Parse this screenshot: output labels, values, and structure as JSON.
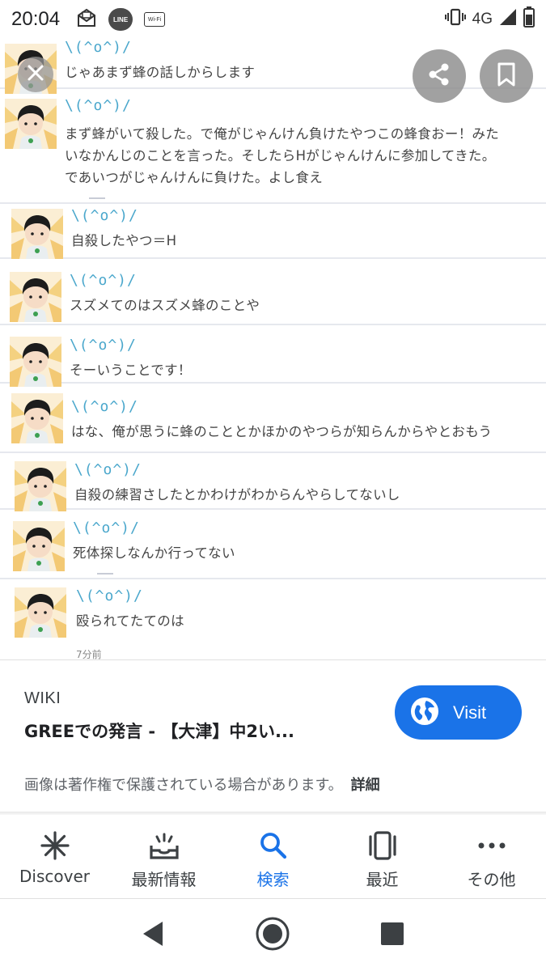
{
  "status_bar": {
    "time": "20:04",
    "icons_left": [
      "mail-icon",
      "line-app-icon",
      "wifi-icon"
    ],
    "line_label": "LINE",
    "wifi_label": "Wi-Fi",
    "network": "4G",
    "icons_right": [
      "vibrate-icon",
      "signal-icon",
      "battery-icon"
    ]
  },
  "image": {
    "kaomoji": "\\(^o^)/",
    "messages": [
      {
        "lines": [
          "じゃあまず蜂の話しからします"
        ]
      },
      {
        "lines": [
          "まず蜂がいて殺した。で俺がじゃんけん負けたやつこの蜂食おー！みた",
          "いなかんじのことを言った。そしたらHがじゃんけんに参加してきた。",
          "であいつがじゃんけんに負けた。よし食え"
        ]
      },
      {
        "lines": [
          "自殺したやつ＝H"
        ]
      },
      {
        "lines": [
          "スズメてのはスズメ蜂のことや"
        ]
      },
      {
        "lines": [
          "そーいうことです！"
        ]
      },
      {
        "lines": [
          "はな、俺が思うに蜂のこととかほかのやつらが知らんからやとおもう"
        ]
      },
      {
        "lines": [
          "自殺の練習さしたとかわけがわからんやらしてないし"
        ]
      },
      {
        "lines": [
          "死体探しなんか行ってない"
        ]
      },
      {
        "lines": [
          "殴られてたてのは"
        ]
      }
    ],
    "timestamp": "7分前"
  },
  "overlay": {
    "close_icon": "close-icon",
    "share_icon": "share-icon",
    "bookmark_icon": "bookmark-icon"
  },
  "info_panel": {
    "source": "WIKI",
    "title": "GREEでの発言 - 【大津】中2い...",
    "visit_label": "Visit",
    "copyright_text": "画像は著作権で保護されている場合があります。",
    "details_label": "詳細"
  },
  "bottom_nav": {
    "items": [
      {
        "label": "Discover",
        "icon": "asterisk-icon"
      },
      {
        "label": "最新情報",
        "icon": "updates-tray-icon"
      },
      {
        "label": "検索",
        "icon": "search-icon",
        "active": true
      },
      {
        "label": "最近",
        "icon": "recent-tabs-icon"
      },
      {
        "label": "その他",
        "icon": "more-dots-icon"
      }
    ]
  },
  "colors": {
    "accent": "#1a73e8",
    "kaomoji": "#4aa7cc",
    "text": "#202124"
  }
}
